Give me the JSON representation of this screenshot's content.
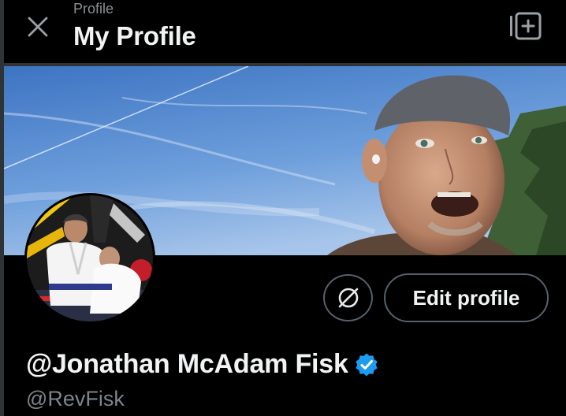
{
  "header": {
    "breadcrumb": "Profile",
    "title": "My Profile",
    "close_icon": "close-icon",
    "add_icon": "add-square-icon"
  },
  "profile": {
    "display_name": "@Jonathan McAdam Fisk",
    "handle": "@RevFisk",
    "verified": true,
    "edit_label": "Edit profile",
    "wallet_icon": "no-tips-icon"
  },
  "colors": {
    "background": "#000000",
    "text": "#e7e9ea",
    "muted": "#7d848b",
    "border": "#56606b",
    "verified_blue": "#1d9bf0"
  }
}
